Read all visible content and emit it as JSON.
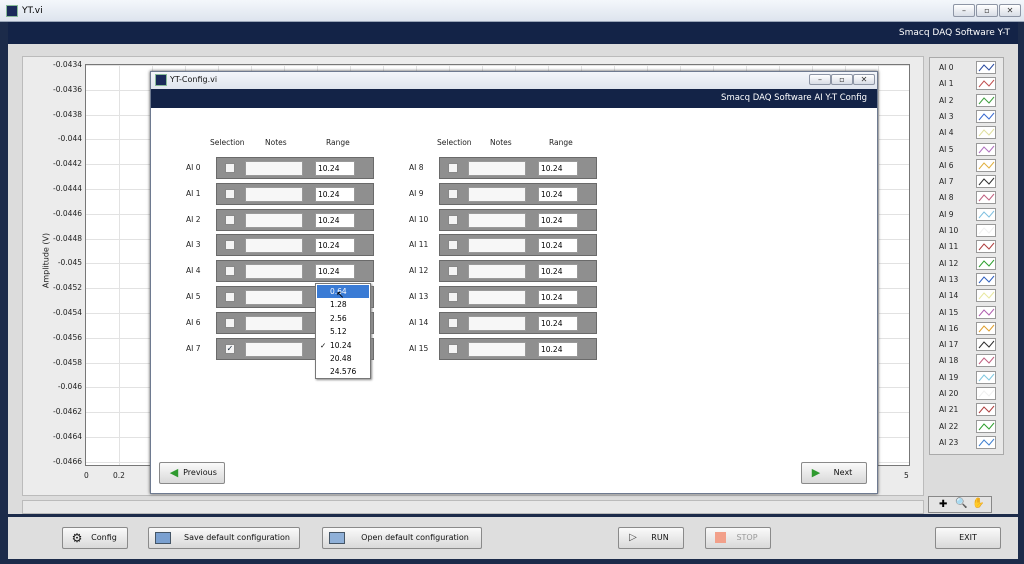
{
  "window": {
    "title": "YT.vi",
    "banner": "Smacq DAQ Software Y-T"
  },
  "chart": {
    "ylabel": "Amplitude (V)",
    "yticks": [
      "-0.0434",
      "-0.0436",
      "-0.0438",
      "-0.044",
      "-0.0442",
      "-0.0444",
      "-0.0446",
      "-0.0448",
      "-0.045",
      "-0.0452",
      "-0.0454",
      "-0.0456",
      "-0.0458",
      "-0.046",
      "-0.0462",
      "-0.0464",
      "-0.0466"
    ],
    "xticks": [
      "0",
      "0.2",
      "5"
    ]
  },
  "legend": [
    {
      "name": "AI 0",
      "color": "#2a4aa0"
    },
    {
      "name": "AI 1",
      "color": "#c05050"
    },
    {
      "name": "AI 2",
      "color": "#40a040"
    },
    {
      "name": "AI 3",
      "color": "#3a6ad0"
    },
    {
      "name": "AI 4",
      "color": "#e0e0a0"
    },
    {
      "name": "AI 5",
      "color": "#b070c0"
    },
    {
      "name": "AI 6",
      "color": "#e0b040"
    },
    {
      "name": "AI 7",
      "color": "#303030"
    },
    {
      "name": "AI 8",
      "color": "#c06080"
    },
    {
      "name": "AI 9",
      "color": "#80c0e0"
    },
    {
      "name": "AI 10",
      "color": "#f0f0f0"
    },
    {
      "name": "AI 11",
      "color": "#b04040"
    },
    {
      "name": "AI 12",
      "color": "#30a030"
    },
    {
      "name": "AI 13",
      "color": "#3060c0"
    },
    {
      "name": "AI 14",
      "color": "#e8e8a0"
    },
    {
      "name": "AI 15",
      "color": "#b060b0"
    },
    {
      "name": "AI 16",
      "color": "#e0a030"
    },
    {
      "name": "AI 17",
      "color": "#303030"
    },
    {
      "name": "AI 18",
      "color": "#c06080"
    },
    {
      "name": "AI 19",
      "color": "#80c8e0"
    },
    {
      "name": "AI 20",
      "color": "#f0f0f0"
    },
    {
      "name": "AI 21",
      "color": "#b04040"
    },
    {
      "name": "AI 22",
      "color": "#30a030"
    },
    {
      "name": "AI 23",
      "color": "#4080d0"
    }
  ],
  "bottom": {
    "config": "Config",
    "save": "Save default configuration",
    "open": "Open default configuration",
    "run": "RUN",
    "stop": "STOP",
    "exit": "EXIT"
  },
  "dialog": {
    "title": "YT-Config.vi",
    "banner": "Smacq DAQ Software AI Y-T Config",
    "headers": {
      "selection": "Selection",
      "notes": "Notes",
      "range": "Range"
    },
    "left": [
      {
        "name": "AI 0",
        "range": "10.24",
        "checked": false
      },
      {
        "name": "AI 1",
        "range": "10.24",
        "checked": false
      },
      {
        "name": "AI 2",
        "range": "10.24",
        "checked": false
      },
      {
        "name": "AI 3",
        "range": "10.24",
        "checked": false
      },
      {
        "name": "AI 4",
        "range": "10.24",
        "checked": false
      },
      {
        "name": "AI 5",
        "range": "",
        "checked": false
      },
      {
        "name": "AI 6",
        "range": "",
        "checked": false
      },
      {
        "name": "AI 7",
        "range": "",
        "checked": true
      }
    ],
    "right": [
      {
        "name": "AI 8",
        "range": "10.24",
        "checked": false
      },
      {
        "name": "AI 9",
        "range": "10.24",
        "checked": false
      },
      {
        "name": "AI 10",
        "range": "10.24",
        "checked": false
      },
      {
        "name": "AI 11",
        "range": "10.24",
        "checked": false
      },
      {
        "name": "AI 12",
        "range": "10.24",
        "checked": false
      },
      {
        "name": "AI 13",
        "range": "10.24",
        "checked": false
      },
      {
        "name": "AI 14",
        "range": "10.24",
        "checked": false
      },
      {
        "name": "AI 15",
        "range": "10.24",
        "checked": false
      }
    ],
    "dropdown": {
      "options": [
        "0.64",
        "1.28",
        "2.56",
        "5.12",
        "10.24",
        "20.48",
        "24.576"
      ],
      "selected": "10.24",
      "highlighted": "0.64"
    },
    "previous": "Previous",
    "next": "Next"
  }
}
